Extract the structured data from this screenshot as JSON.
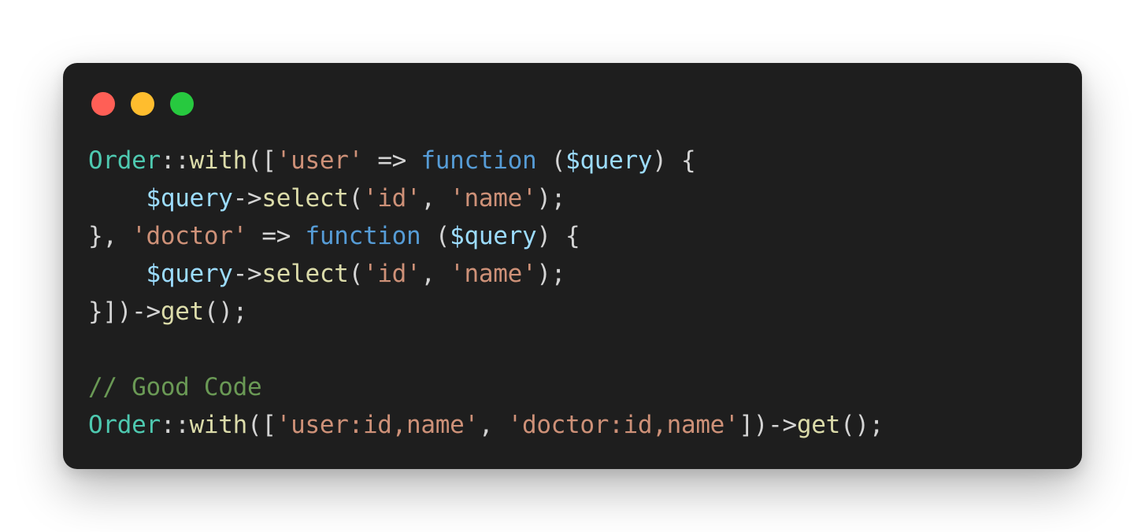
{
  "window": {
    "dots": [
      {
        "name": "close",
        "color": "#ff5f56"
      },
      {
        "name": "minimize",
        "color": "#ffbd2e"
      },
      {
        "name": "maximize",
        "color": "#27c93f"
      }
    ]
  },
  "code": {
    "lines": [
      [
        {
          "t": "class",
          "v": "Order"
        },
        {
          "t": "punc",
          "v": "::"
        },
        {
          "t": "method",
          "v": "with"
        },
        {
          "t": "punc",
          "v": "(["
        },
        {
          "t": "string",
          "v": "'user'"
        },
        {
          "t": "punc",
          "v": " => "
        },
        {
          "t": "keyword",
          "v": "function"
        },
        {
          "t": "punc",
          "v": " ("
        },
        {
          "t": "variable",
          "v": "$query"
        },
        {
          "t": "punc",
          "v": ") {"
        }
      ],
      [
        {
          "t": "punc",
          "v": "    "
        },
        {
          "t": "variable",
          "v": "$query"
        },
        {
          "t": "punc",
          "v": "->"
        },
        {
          "t": "method",
          "v": "select"
        },
        {
          "t": "punc",
          "v": "("
        },
        {
          "t": "string",
          "v": "'id'"
        },
        {
          "t": "punc",
          "v": ", "
        },
        {
          "t": "string",
          "v": "'name'"
        },
        {
          "t": "punc",
          "v": ");"
        }
      ],
      [
        {
          "t": "punc",
          "v": "}, "
        },
        {
          "t": "string",
          "v": "'doctor'"
        },
        {
          "t": "punc",
          "v": " => "
        },
        {
          "t": "keyword",
          "v": "function"
        },
        {
          "t": "punc",
          "v": " ("
        },
        {
          "t": "variable",
          "v": "$query"
        },
        {
          "t": "punc",
          "v": ") {"
        }
      ],
      [
        {
          "t": "punc",
          "v": "    "
        },
        {
          "t": "variable",
          "v": "$query"
        },
        {
          "t": "punc",
          "v": "->"
        },
        {
          "t": "method",
          "v": "select"
        },
        {
          "t": "punc",
          "v": "("
        },
        {
          "t": "string",
          "v": "'id'"
        },
        {
          "t": "punc",
          "v": ", "
        },
        {
          "t": "string",
          "v": "'name'"
        },
        {
          "t": "punc",
          "v": ");"
        }
      ],
      [
        {
          "t": "punc",
          "v": "}])->"
        },
        {
          "t": "method",
          "v": "get"
        },
        {
          "t": "punc",
          "v": "();"
        }
      ],
      [],
      [
        {
          "t": "comment",
          "v": "// Good Code"
        }
      ],
      [
        {
          "t": "class",
          "v": "Order"
        },
        {
          "t": "punc",
          "v": "::"
        },
        {
          "t": "method",
          "v": "with"
        },
        {
          "t": "punc",
          "v": "(["
        },
        {
          "t": "string",
          "v": "'user:id,name'"
        },
        {
          "t": "punc",
          "v": ", "
        },
        {
          "t": "string",
          "v": "'doctor:id,name'"
        },
        {
          "t": "punc",
          "v": "])->"
        },
        {
          "t": "method",
          "v": "get"
        },
        {
          "t": "punc",
          "v": "();"
        }
      ]
    ]
  }
}
